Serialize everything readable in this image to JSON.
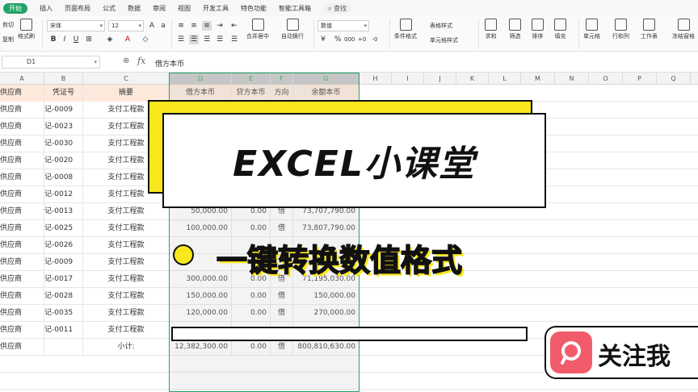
{
  "ribbon": {
    "tabs": [
      "开始",
      "插入",
      "页面布局",
      "公式",
      "数据",
      "审阅",
      "视图",
      "开发工具",
      "特色功能",
      "智能工具箱",
      "查找"
    ],
    "cut": "剪切",
    "copy": "复制",
    "format_painter": "格式刷",
    "font_name": "宋体",
    "font_size": "12",
    "merge": "合并居中",
    "wrap": "自动换行",
    "number_format": "数值",
    "table_style": "表格样式",
    "cond_format": "条件格式",
    "cell_style": "单元格样式",
    "sum": "求和",
    "filter": "筛选",
    "sort": "排序",
    "fill": "填充",
    "cell": "单元格",
    "rowcol": "行和列",
    "worksheet": "工作表",
    "freeze": "冻结窗格"
  },
  "formula_bar": {
    "name_box": "D1",
    "fx": "fx",
    "content": "借方本币"
  },
  "columns": [
    "A",
    "B",
    "C",
    "D",
    "E",
    "F",
    "G",
    "H",
    "I",
    "J",
    "K",
    "L",
    "M",
    "N",
    "O",
    "P",
    "Q"
  ],
  "header_row": [
    "供应商",
    "凭证号",
    "摘要",
    "借方本币",
    "贷方本币",
    "方向",
    "余额本币"
  ],
  "rows": [
    {
      "a": "供应商",
      "b": "记-0009",
      "c": "支付工程款",
      "d": "",
      "e": "",
      "f": "",
      "g": ""
    },
    {
      "a": "供应商",
      "b": "记-0023",
      "c": "支付工程款",
      "d": "",
      "e": "",
      "f": "",
      "g": ""
    },
    {
      "a": "供应商",
      "b": "记-0030",
      "c": "支付工程款",
      "d": "",
      "e": "",
      "f": "",
      "g": ""
    },
    {
      "a": "供应商",
      "b": "记-0020",
      "c": "支付工程款",
      "d": "",
      "e": "",
      "f": "",
      "g": ""
    },
    {
      "a": "供应商",
      "b": "记-0008",
      "c": "支付工程款",
      "d": "",
      "e": "",
      "f": "",
      "g": ""
    },
    {
      "a": "供应商",
      "b": "记-0012",
      "c": "支付工程款",
      "d": "",
      "e": "",
      "f": "",
      "g": ""
    },
    {
      "a": "供应商",
      "b": "记-0013",
      "c": "支付工程款",
      "d": "50,000.00",
      "e": "0.00",
      "f": "借",
      "g": "73,707,790.00"
    },
    {
      "a": "供应商",
      "b": "记-0025",
      "c": "支付工程款",
      "d": "100,000.00",
      "e": "0.00",
      "f": "借",
      "g": "73,807,790.00"
    },
    {
      "a": "供应商",
      "b": "记-0026",
      "c": "支付工程款",
      "d": "",
      "e": "",
      "f": "",
      "g": ""
    },
    {
      "a": "供应商",
      "b": "记-0009",
      "c": "支付工程款",
      "d": "",
      "e": "",
      "f": "",
      "g": ""
    },
    {
      "a": "供应商",
      "b": "记-0017",
      "c": "支付工程款",
      "d": "300,000.00",
      "e": "0.00",
      "f": "借",
      "g": "71,195,030.00"
    },
    {
      "a": "供应商",
      "b": "记-0028",
      "c": "支付工程款",
      "d": "150,000.00",
      "e": "0.00",
      "f": "借",
      "g": "150,000.00"
    },
    {
      "a": "供应商",
      "b": "记-0035",
      "c": "支付工程款",
      "d": "120,000.00",
      "e": "0.00",
      "f": "借",
      "g": "270,000.00"
    },
    {
      "a": "供应商",
      "b": "记-0011",
      "c": "支付工程款",
      "d": "",
      "e": "",
      "f": "",
      "g": ""
    },
    {
      "a": "供应商",
      "b": "",
      "c": "小计:",
      "d": "12,382,300.00",
      "e": "0.00",
      "f": "借",
      "g": "800,810,630.00"
    }
  ],
  "overlay": {
    "title": "EXCEL小课堂",
    "subtitle": "一键转换数值格式",
    "follow": "关注我"
  },
  "colors": {
    "accent": "#21a366",
    "header_fill": "#fde9db",
    "highlight": "#f8e71c",
    "follow_icon": "#f25b6b"
  }
}
